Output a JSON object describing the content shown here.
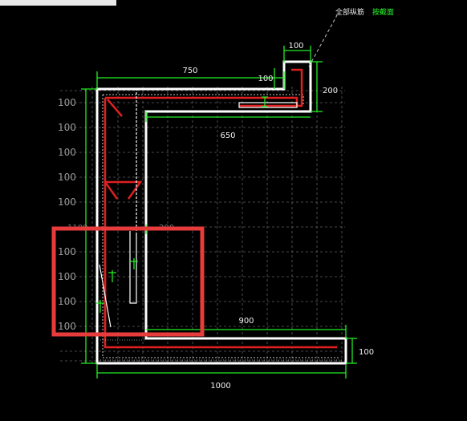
{
  "legend": {
    "main_label": "全部纵筋",
    "accent_label": "按截面"
  },
  "dimensions": {
    "top_width": "750",
    "top_cap_width": "100",
    "top_inner_offset": "100",
    "top_right_height": "200",
    "inner_top_width": "650",
    "bottom_inner_width": "900",
    "bottom_width": "1000",
    "bottom_right_height": "100",
    "left_height": "1100",
    "inner_stem_width": "200"
  },
  "grid": {
    "row_label": "100",
    "row_count": 10
  },
  "colors": {
    "background": "#000000",
    "outline": "#ffffff",
    "dimension": "#22ee22",
    "rebar": "#e02020",
    "highlight": "#e83b3b",
    "grid": "#666666"
  }
}
